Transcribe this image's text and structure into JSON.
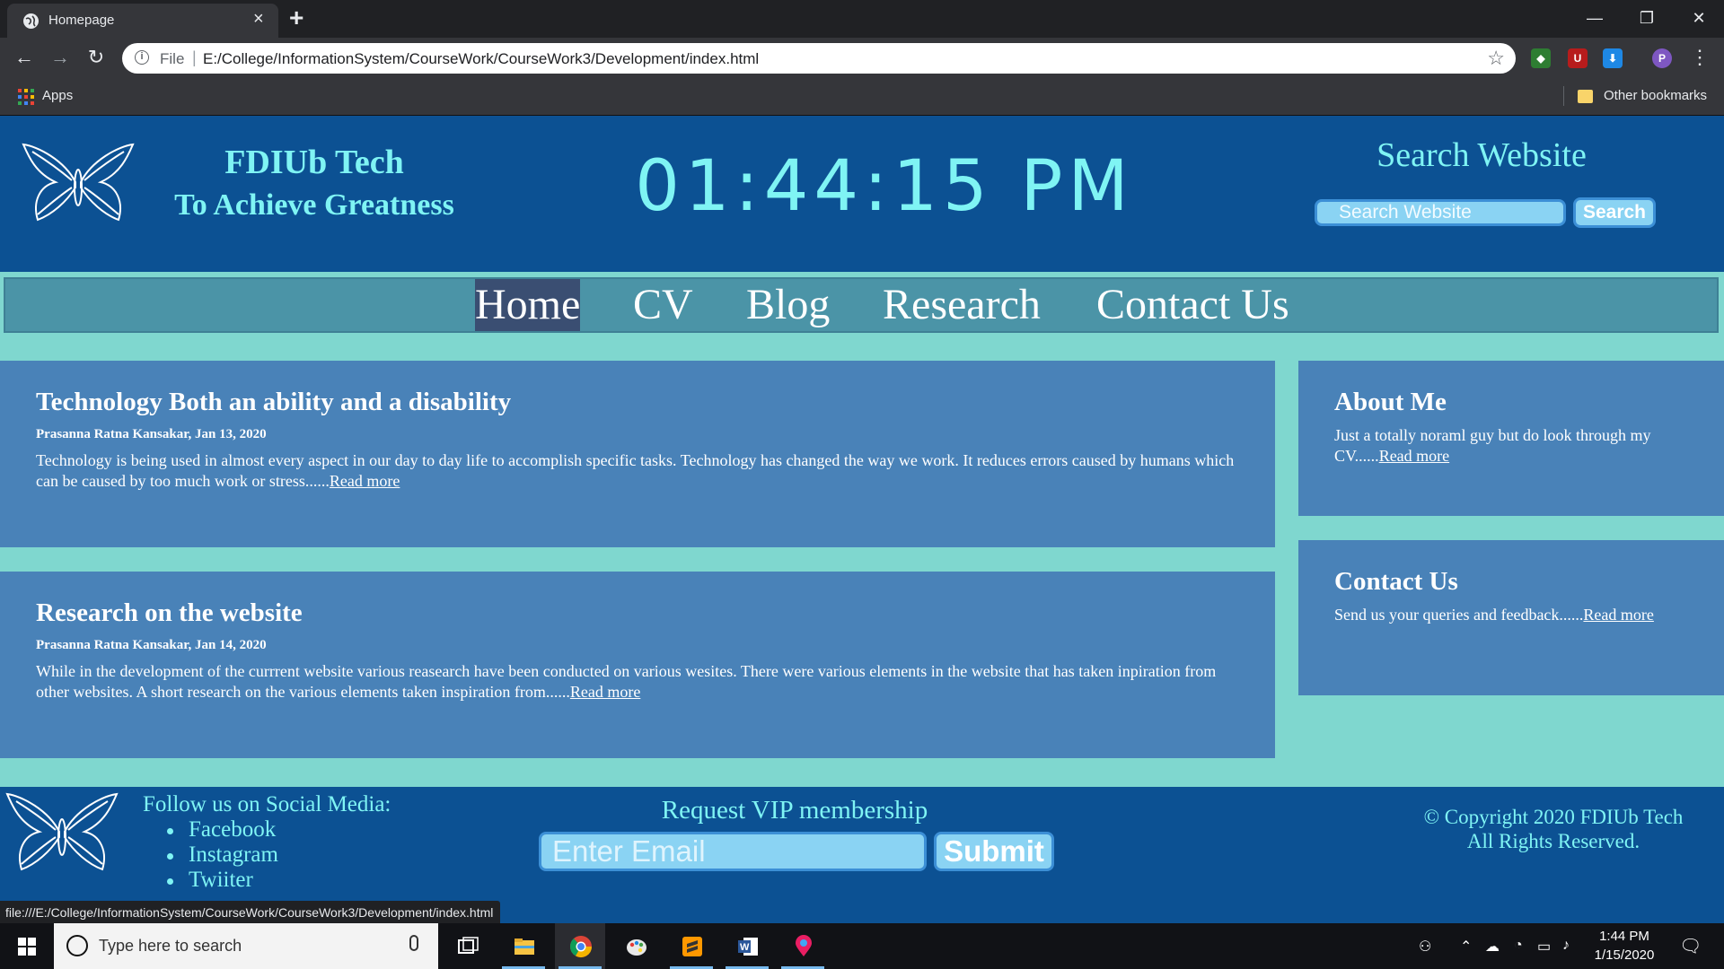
{
  "browser": {
    "tab_title": "Homepage",
    "tab_close": "×",
    "new_tab": "+",
    "window_controls": {
      "minimize": "—",
      "restore": "❐",
      "close": "✕"
    },
    "nav": {
      "back": "←",
      "forward": "→",
      "reload": "↻"
    },
    "url_scheme_label": "File",
    "url_separator": "|",
    "url": "E:/College/InformationSystem/CourseWork/CourseWork3/Development/index.html",
    "star": "☆",
    "profile_initial": "P",
    "menu": "⋮",
    "bookmarks": {
      "apps_label": "Apps",
      "other_label": "Other bookmarks"
    },
    "status_url": "file:///E:/College/InformationSystem/CourseWork/CourseWork3/Development/index.html"
  },
  "header": {
    "brand_name": "FDIUb Tech",
    "brand_tagline": "To Achieve Greatness",
    "clock": "01:44:15 PM",
    "search_title": "Search Website",
    "search_placeholder": "Search Website",
    "search_button": "Search"
  },
  "nav": {
    "items": [
      "Home",
      "CV",
      "Blog",
      "Research",
      "Contact Us"
    ],
    "active": "Home"
  },
  "posts": [
    {
      "title": "Technology Both an ability and a disability",
      "meta": "Prasanna Ratna Kansakar, Jan 13, 2020",
      "body": "Technology is being used in almost every aspect in our day to day life to accomplish specific tasks. Technology has changed the way we work. It reduces errors caused by humans which can be caused by too much work or stress......",
      "link": "Read more"
    },
    {
      "title": "Research on the website",
      "meta": "Prasanna Ratna Kansakar, Jan 14, 2020",
      "body": "While in the development of the currrent website various reasearch have been conducted on various wesites. There were various elements in the website that has taken inpiration from other websites. A short research on the various elements taken inspiration from......",
      "link": "Read more"
    }
  ],
  "sidebar": {
    "about": {
      "title": "About Me",
      "body": "Just a totally noraml guy but do look through my CV......",
      "link": "Read more"
    },
    "contact": {
      "title": "Contact Us",
      "body": "Send us your queries and feedback......",
      "link": "Read more"
    }
  },
  "footer": {
    "follow_label": "Follow us on Social Media:",
    "social": [
      "Facebook",
      "Instagram",
      "Twiiter"
    ],
    "vip_title": "Request VIP membership",
    "email_placeholder": "Enter Email",
    "submit_label": "Submit",
    "copyright_line1": "© Copyright 2020 FDIUb Tech",
    "copyright_line2": "All Rights Reserved."
  },
  "taskbar": {
    "search_placeholder": "Type here to search",
    "time": "1:44 PM",
    "date": "1/15/2020",
    "apps": [
      "task-view",
      "file-explorer",
      "chrome",
      "paint",
      "sublime-text",
      "word",
      "maps"
    ]
  },
  "colors": {
    "header_bg": "#0c5193",
    "accent_cyan": "#7ff4f4",
    "page_bg": "#7fd7cf",
    "card_bg": "#4982b8",
    "nav_bg": "#4b94a7",
    "nav_active": "#3a4e72"
  }
}
